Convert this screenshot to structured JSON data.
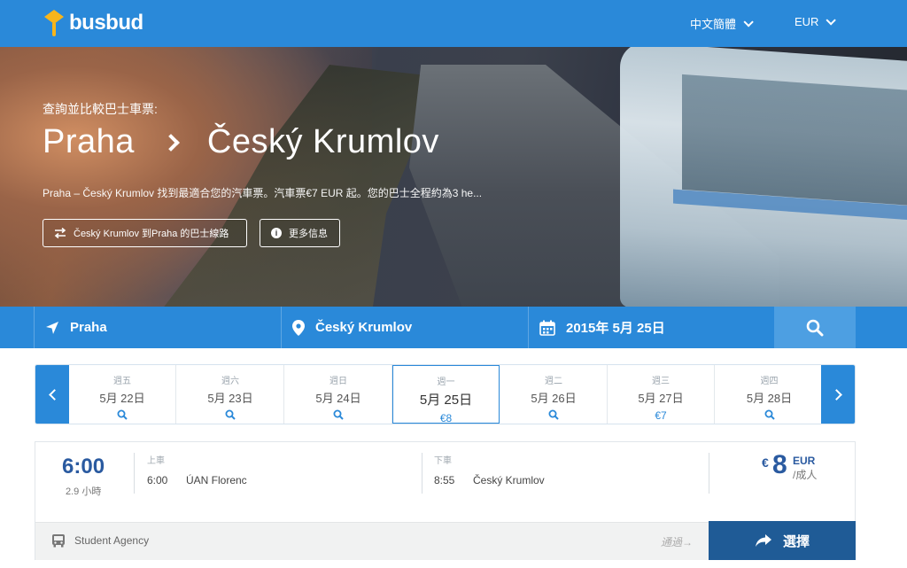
{
  "header": {
    "logo_text": "busbud",
    "language": "中文簡體",
    "currency": "EUR"
  },
  "hero": {
    "subtitle": "查詢並比較巴士車票:",
    "origin": "Praha",
    "destination": "Český Krumlov",
    "description": "Praha – Český Krumlov 找到最適合您的汽車票。汽車票€7 EUR 起。您的巴士全程約為3 he...",
    "routes_button": "Český Krumlov 到Praha 的巴士線路",
    "info_button": "更多信息"
  },
  "search": {
    "from": "Praha",
    "to": "Český Krumlov",
    "date": "2015年 5月 25日"
  },
  "days": [
    {
      "dow": "週五",
      "date": "5月 22日",
      "sub": "",
      "active": false
    },
    {
      "dow": "週六",
      "date": "5月 23日",
      "sub": "",
      "active": false
    },
    {
      "dow": "週日",
      "date": "5月 24日",
      "sub": "",
      "active": false
    },
    {
      "dow": "週一",
      "date": "5月 25日",
      "sub": "€8",
      "active": true
    },
    {
      "dow": "週二",
      "date": "5月 26日",
      "sub": "",
      "active": false
    },
    {
      "dow": "週三",
      "date": "5月 27日",
      "sub": "€7",
      "active": false
    },
    {
      "dow": "週四",
      "date": "5月 28日",
      "sub": "",
      "active": false
    }
  ],
  "result": {
    "departure_time": "6:00",
    "duration": "2.9 小時",
    "board_label": "上車",
    "board_time": "6:00",
    "board_station": "ÚAN Florenc",
    "alight_label": "下車",
    "alight_time": "8:55",
    "alight_station": "Český Krumlov",
    "price_symbol": "€",
    "price_value": "8",
    "price_currency": "EUR",
    "price_per": "/成人",
    "operator": "Student Agency",
    "via": "通過→",
    "select_label": "選擇"
  },
  "colors": {
    "brand_blue": "#2a89d9",
    "dark_blue": "#1f5b96",
    "price_blue": "#2a5aa0",
    "logo_yellow": "#f7b51c"
  }
}
